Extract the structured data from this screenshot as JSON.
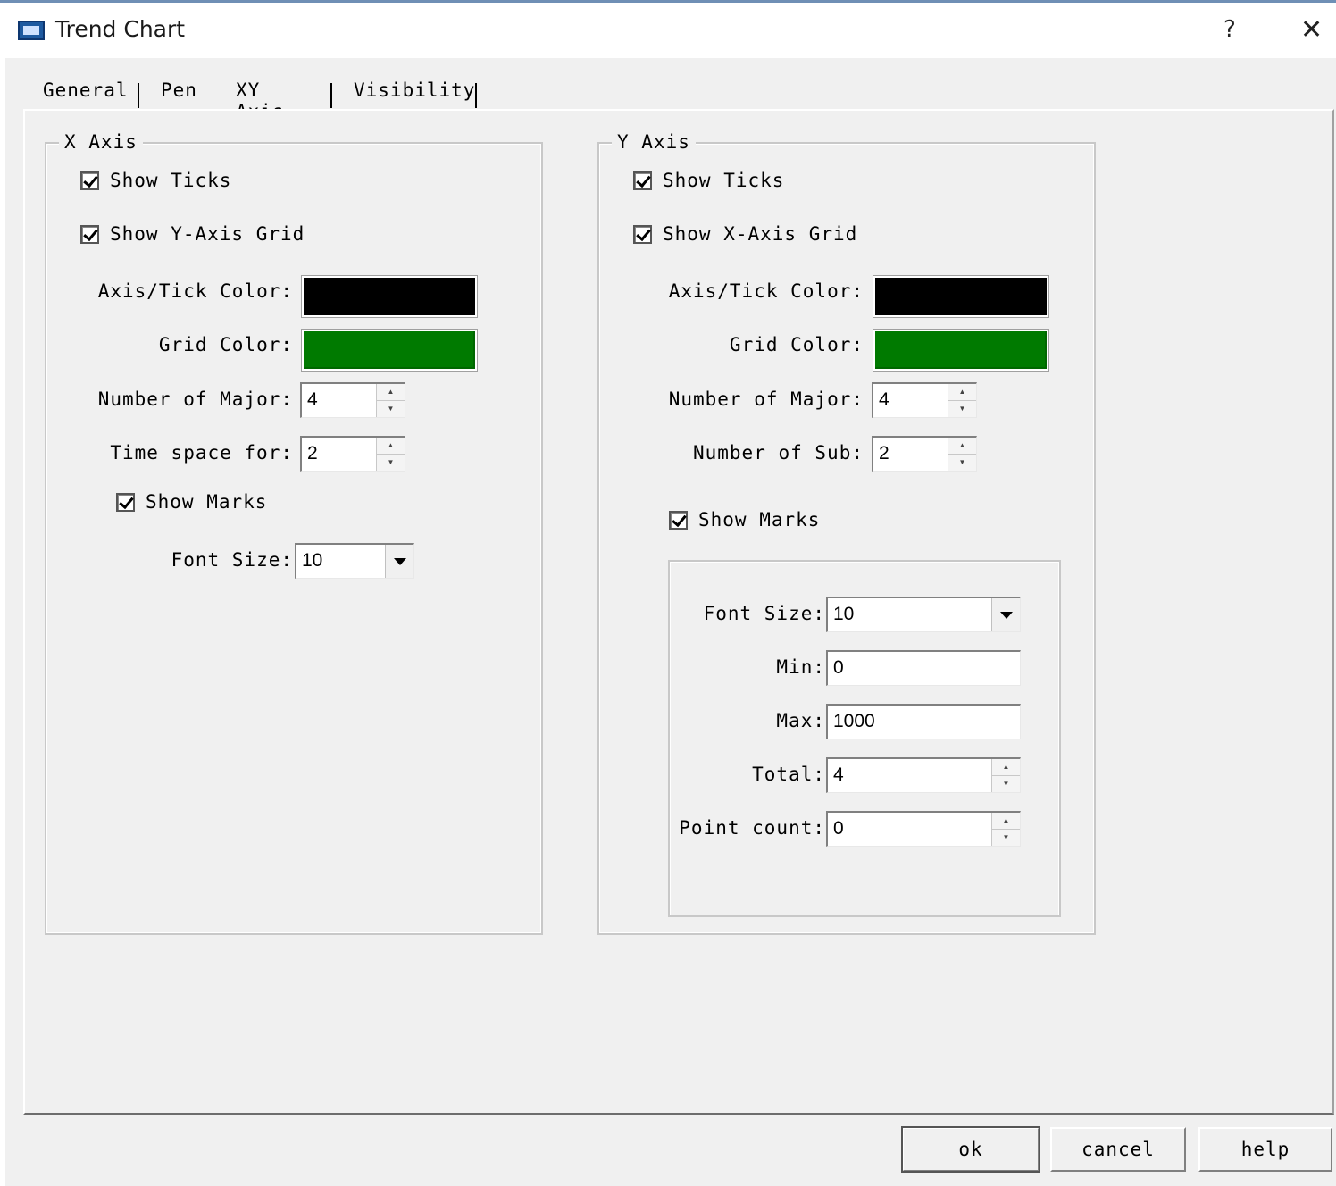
{
  "window": {
    "title": "Trend Chart",
    "help_glyph": "?",
    "close_glyph": "✕"
  },
  "tabs": [
    {
      "label": "General"
    },
    {
      "label": "Pen"
    },
    {
      "label": "XY Axis"
    },
    {
      "label": "Visibility"
    }
  ],
  "active_tab": "XY Axis",
  "x_axis": {
    "legend": "X Axis",
    "show_ticks": {
      "label": "Show Ticks",
      "checked": true
    },
    "show_grid": {
      "label": "Show Y-Axis Grid",
      "checked": true
    },
    "axis_tick_color": {
      "label": "Axis/Tick Color:",
      "value": "#000000"
    },
    "grid_color": {
      "label": "Grid Color:",
      "value": "#007a00"
    },
    "number_of_major": {
      "label": "Number of Major:",
      "value": "4"
    },
    "time_space_for": {
      "label": "Time space for:",
      "value": "2"
    },
    "show_marks": {
      "label": "Show Marks",
      "checked": true
    },
    "font_size": {
      "label": "Font Size:",
      "value": "10"
    }
  },
  "y_axis": {
    "legend": "Y Axis",
    "show_ticks": {
      "label": "Show Ticks",
      "checked": true
    },
    "show_grid": {
      "label": "Show X-Axis Grid",
      "checked": true
    },
    "axis_tick_color": {
      "label": "Axis/Tick Color:",
      "value": "#000000"
    },
    "grid_color": {
      "label": "Grid Color:",
      "value": "#007a00"
    },
    "number_of_major": {
      "label": "Number of Major:",
      "value": "4"
    },
    "number_of_sub": {
      "label": "Number of Sub:",
      "value": "2"
    },
    "show_marks": {
      "label": "Show Marks",
      "checked": true
    },
    "font_size": {
      "label": "Font Size:",
      "value": "10"
    },
    "min": {
      "label": "Min:",
      "value": "0"
    },
    "max": {
      "label": "Max:",
      "value": "1000"
    },
    "total": {
      "label": "Total:",
      "value": "4"
    },
    "point_count": {
      "label": "Point count:",
      "value": "0"
    }
  },
  "buttons": {
    "ok": "ok",
    "cancel": "cancel",
    "help": "help"
  }
}
